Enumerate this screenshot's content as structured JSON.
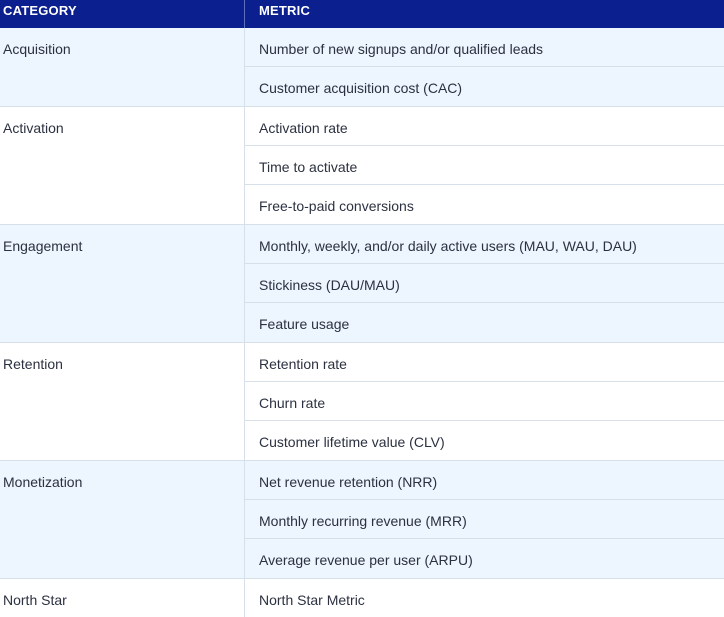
{
  "header": {
    "category": "CATEGORY",
    "metric": "METRIC"
  },
  "groups": [
    {
      "category": "Acquisition",
      "metrics": [
        "Number of new signups and/or qualified leads",
        "Customer acquisition cost (CAC)"
      ]
    },
    {
      "category": "Activation",
      "metrics": [
        "Activation rate",
        "Time to activate",
        "Free-to-paid conversions"
      ]
    },
    {
      "category": "Engagement",
      "metrics": [
        "Monthly, weekly, and/or daily active users (MAU, WAU, DAU)",
        "Stickiness (DAU/MAU)",
        "Feature usage"
      ]
    },
    {
      "category": "Retention",
      "metrics": [
        "Retention rate",
        "Churn rate",
        "Customer lifetime value (CLV)"
      ]
    },
    {
      "category": "Monetization",
      "metrics": [
        "Net revenue retention (NRR)",
        "Monthly recurring revenue (MRR)",
        "Average revenue per user (ARPU)"
      ]
    },
    {
      "category": "North Star",
      "metrics": [
        "North Star Metric"
      ]
    }
  ],
  "colors": {
    "header_bg": "#0b1f8f",
    "shaded_row": "#edf5fe",
    "border": "#d7dfe9"
  }
}
